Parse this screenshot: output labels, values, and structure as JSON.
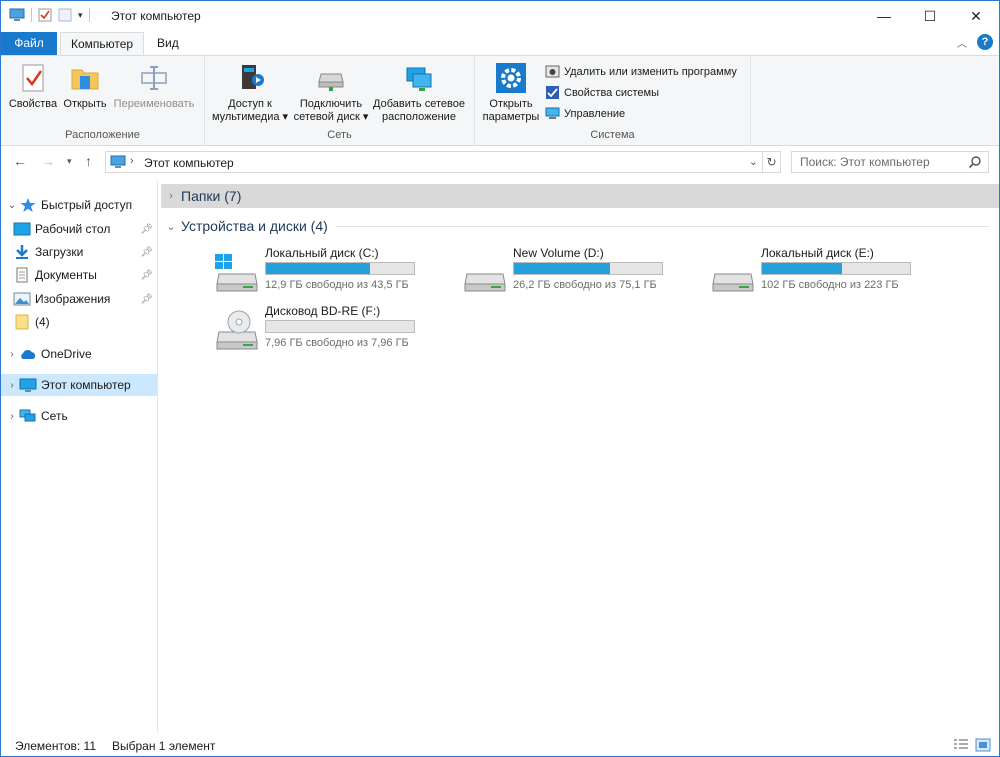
{
  "window": {
    "title": "Этот компьютер",
    "controls": {
      "minimize": "—",
      "maximize": "☐",
      "close": "✕"
    }
  },
  "ribbon_tabs": {
    "file": "Файл",
    "computer": "Компьютер",
    "view": "Вид"
  },
  "ribbon": {
    "location_group": {
      "label": "Расположение",
      "properties": "Свойства",
      "open": "Открыть",
      "rename": "Переименовать"
    },
    "network_group": {
      "label": "Сеть",
      "media_line1": "Доступ к",
      "media_line2": "мультимедиа ▾",
      "map_line1": "Подключить",
      "map_line2": "сетевой диск ▾",
      "add_line1": "Добавить сетевое",
      "add_line2": "расположение"
    },
    "system_group": {
      "label": "Система",
      "settings_line1": "Открыть",
      "settings_line2": "параметры",
      "uninstall": "Удалить или изменить программу",
      "system_properties": "Свойства системы",
      "manage": "Управление"
    }
  },
  "address": {
    "path": "Этот компьютер",
    "search_placeholder": "Поиск: Этот компьютер"
  },
  "nav": {
    "quick_access": "Быстрый доступ",
    "desktop": "Рабочий стол",
    "downloads": "Загрузки",
    "documents": "Документы",
    "pictures": "Изображения",
    "folder4": "(4)",
    "onedrive": "OneDrive",
    "this_pc": "Этот компьютер",
    "network": "Сеть"
  },
  "content": {
    "folders_header": "Папки (7)",
    "devices_header": "Устройства и диски (4)",
    "drives": [
      {
        "name": "Локальный диск (C:)",
        "free": "12,9 ГБ свободно из 43,5 ГБ",
        "used_fraction": 0.7
      },
      {
        "name": "New Volume (D:)",
        "free": "26,2 ГБ свободно из 75,1 ГБ",
        "used_fraction": 0.65
      },
      {
        "name": "Локальный диск (E:)",
        "free": "102 ГБ свободно из 223 ГБ",
        "used_fraction": 0.54
      },
      {
        "name": "Дисковод BD-RE (F:)",
        "free": "7,96 ГБ свободно из 7,96 ГБ",
        "used_fraction": 0.0
      }
    ]
  },
  "status": {
    "count": "Элементов: 11",
    "selected": "Выбран 1 элемент"
  },
  "colors": {
    "accent": "#1979ca",
    "drive_bar": "#26a0da",
    "selection": "#cce8ff"
  }
}
